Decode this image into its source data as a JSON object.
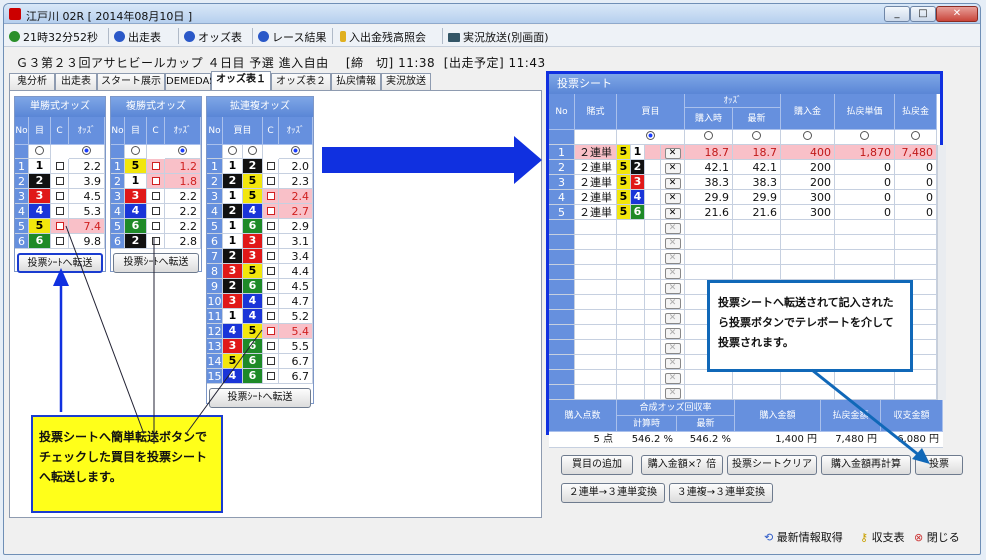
{
  "window": {
    "title": "江戸川 02R [ 2014年08月10日 ]",
    "min": "_",
    "max": "□",
    "close": "✕"
  },
  "toolbar": {
    "clock": "21時32分52秒",
    "items": [
      "出走表",
      "オッズ表",
      "レース結果",
      "入出金残高照会",
      "実況放送(別画面)"
    ]
  },
  "race": {
    "name": "Ｇ３第２３回アサヒビールカップ ４日目 予選 進入自由",
    "deadline_label": "[締　切]",
    "deadline": "11:38",
    "start_label": "[出走予定]",
    "start": "11:43"
  },
  "tabs": [
    "鬼分析",
    "出走表",
    "スタート展示",
    "DEMEDAS",
    "オッズ表１",
    "オッズ表２",
    "払戻情報",
    "実況放送"
  ],
  "active_tab": 4,
  "tansho": {
    "title": "単勝式オッズ",
    "cols": [
      "No",
      "目",
      "C",
      "ｵｯｽﾞ"
    ],
    "rows": [
      {
        "no": "1",
        "odds": "2.2",
        "hl": false
      },
      {
        "no": "2",
        "odds": "3.9",
        "hl": false
      },
      {
        "no": "3",
        "odds": "4.5",
        "hl": false
      },
      {
        "no": "4",
        "odds": "5.3",
        "hl": false
      },
      {
        "no": "5",
        "odds": "7.4",
        "hl": true
      },
      {
        "no": "6",
        "odds": "9.8",
        "hl": false
      }
    ],
    "button": "投票ｼｰﾄへ転送"
  },
  "fukusho": {
    "title": "複勝式オッズ",
    "cols": [
      "No",
      "目",
      "C",
      "ｵｯｽﾞ"
    ],
    "rows": [
      {
        "no": "1",
        "boat": "5",
        "odds": "1.2",
        "hl": true
      },
      {
        "no": "2",
        "boat": "1",
        "odds": "1.8",
        "hl": true
      },
      {
        "no": "3",
        "boat": "3",
        "odds": "2.2",
        "hl": false
      },
      {
        "no": "4",
        "boat": "4",
        "odds": "2.2",
        "hl": false
      },
      {
        "no": "5",
        "boat": "6",
        "odds": "2.2",
        "hl": false
      },
      {
        "no": "6",
        "boat": "2",
        "odds": "2.8",
        "hl": false
      }
    ],
    "button": "投票ｼｰﾄへ転送"
  },
  "kakuren": {
    "title": "拡連複オッズ",
    "cols": [
      "No",
      "買目",
      "C",
      "ｵｯｽﾞ"
    ],
    "rows": [
      {
        "no": "1",
        "a": "1",
        "b": "2",
        "odds": "2.0",
        "hl": false
      },
      {
        "no": "2",
        "a": "2",
        "b": "5",
        "odds": "2.3",
        "hl": false
      },
      {
        "no": "3",
        "a": "1",
        "b": "5",
        "odds": "2.4",
        "hl": true
      },
      {
        "no": "4",
        "a": "2",
        "b": "4",
        "odds": "2.7",
        "hl": true
      },
      {
        "no": "5",
        "a": "1",
        "b": "6",
        "odds": "2.9",
        "hl": false
      },
      {
        "no": "6",
        "a": "1",
        "b": "3",
        "odds": "3.1",
        "hl": false
      },
      {
        "no": "7",
        "a": "2",
        "b": "3",
        "odds": "3.4",
        "hl": false
      },
      {
        "no": "8",
        "a": "3",
        "b": "5",
        "odds": "4.4",
        "hl": false
      },
      {
        "no": "9",
        "a": "2",
        "b": "6",
        "odds": "4.5",
        "hl": false
      },
      {
        "no": "10",
        "a": "3",
        "b": "4",
        "odds": "4.7",
        "hl": false
      },
      {
        "no": "11",
        "a": "1",
        "b": "4",
        "odds": "5.2",
        "hl": false
      },
      {
        "no": "12",
        "a": "4",
        "b": "5",
        "odds": "5.4",
        "hl": true
      },
      {
        "no": "13",
        "a": "3",
        "b": "6",
        "odds": "5.5",
        "hl": false
      },
      {
        "no": "14",
        "a": "5",
        "b": "6",
        "odds": "6.7",
        "hl": false
      },
      {
        "no": "15",
        "a": "4",
        "b": "6",
        "odds": "6.7",
        "hl": false
      }
    ],
    "button": "投票ｼｰﾄへ転送"
  },
  "sheet": {
    "title": "投票シート",
    "cols": {
      "no": "No",
      "type": "賭式",
      "kaime": "買目",
      "odds": "ｵｯｽﾞ",
      "odds_buy": "購入時",
      "odds_latest": "最新",
      "amount": "購入金",
      "payout_unit": "払戻単価",
      "payout": "払戻金"
    },
    "rows": [
      {
        "no": "1",
        "type": "２連単",
        "a": "5",
        "b": "1",
        "o1": "18.7",
        "o2": "18.7",
        "amt": "400",
        "unit": "1,870",
        "pay": "7,480",
        "hl": true
      },
      {
        "no": "2",
        "type": "２連単",
        "a": "5",
        "b": "2",
        "o1": "42.1",
        "o2": "42.1",
        "amt": "200",
        "unit": "0",
        "pay": "0",
        "hl": false
      },
      {
        "no": "3",
        "type": "２連単",
        "a": "5",
        "b": "3",
        "o1": "38.3",
        "o2": "38.3",
        "amt": "200",
        "unit": "0",
        "pay": "0",
        "hl": false
      },
      {
        "no": "4",
        "type": "２連単",
        "a": "5",
        "b": "4",
        "o1": "29.9",
        "o2": "29.9",
        "amt": "300",
        "unit": "0",
        "pay": "0",
        "hl": false
      },
      {
        "no": "5",
        "type": "２連単",
        "a": "5",
        "b": "6",
        "o1": "21.6",
        "o2": "21.6",
        "amt": "300",
        "unit": "0",
        "pay": "0",
        "hl": false
      }
    ],
    "del": "✕",
    "footer": {
      "points": "購入点数",
      "combined": "合成オッズ回収率",
      "calc": "計算時",
      "latest": "最新",
      "total_amount": "購入金額",
      "payout_amount": "払戻金額",
      "balance": "収支金額"
    },
    "summary": {
      "points": "5 点",
      "calc": "546.2 %",
      "latest": "546.2 %",
      "amount": "1,400 円",
      "payout": "7,480 円",
      "balance": "6,080 円"
    }
  },
  "buttons": {
    "add": "買目の追加",
    "mult": "購入金額×？倍",
    "clear": "投票シートクリア",
    "recalc": "購入金額再計算",
    "vote": "投票",
    "conv1": "２連単→３連単変換",
    "conv2": "３連複→３連単変換"
  },
  "notes": {
    "left": "投票シートへ簡単転送ボタンでチェックした買目を投票シートへ転送します。",
    "right": "投票シートへ転送されて記入されたら投票ボタンでテレボートを介して投票されます。"
  },
  "bottom": {
    "refresh": "最新情報取得",
    "ledger": "収支表",
    "close": "閉じる"
  },
  "colors": {
    "1": "#ffffff",
    "2": "#111111",
    "3": "#e01818",
    "4": "#1a35d8",
    "5": "#f2e60c",
    "6": "#1e8a28",
    "header": "#6690de",
    "accent": "#1030e0",
    "note": "#ffff1a",
    "hl": "#f9c0c8"
  }
}
